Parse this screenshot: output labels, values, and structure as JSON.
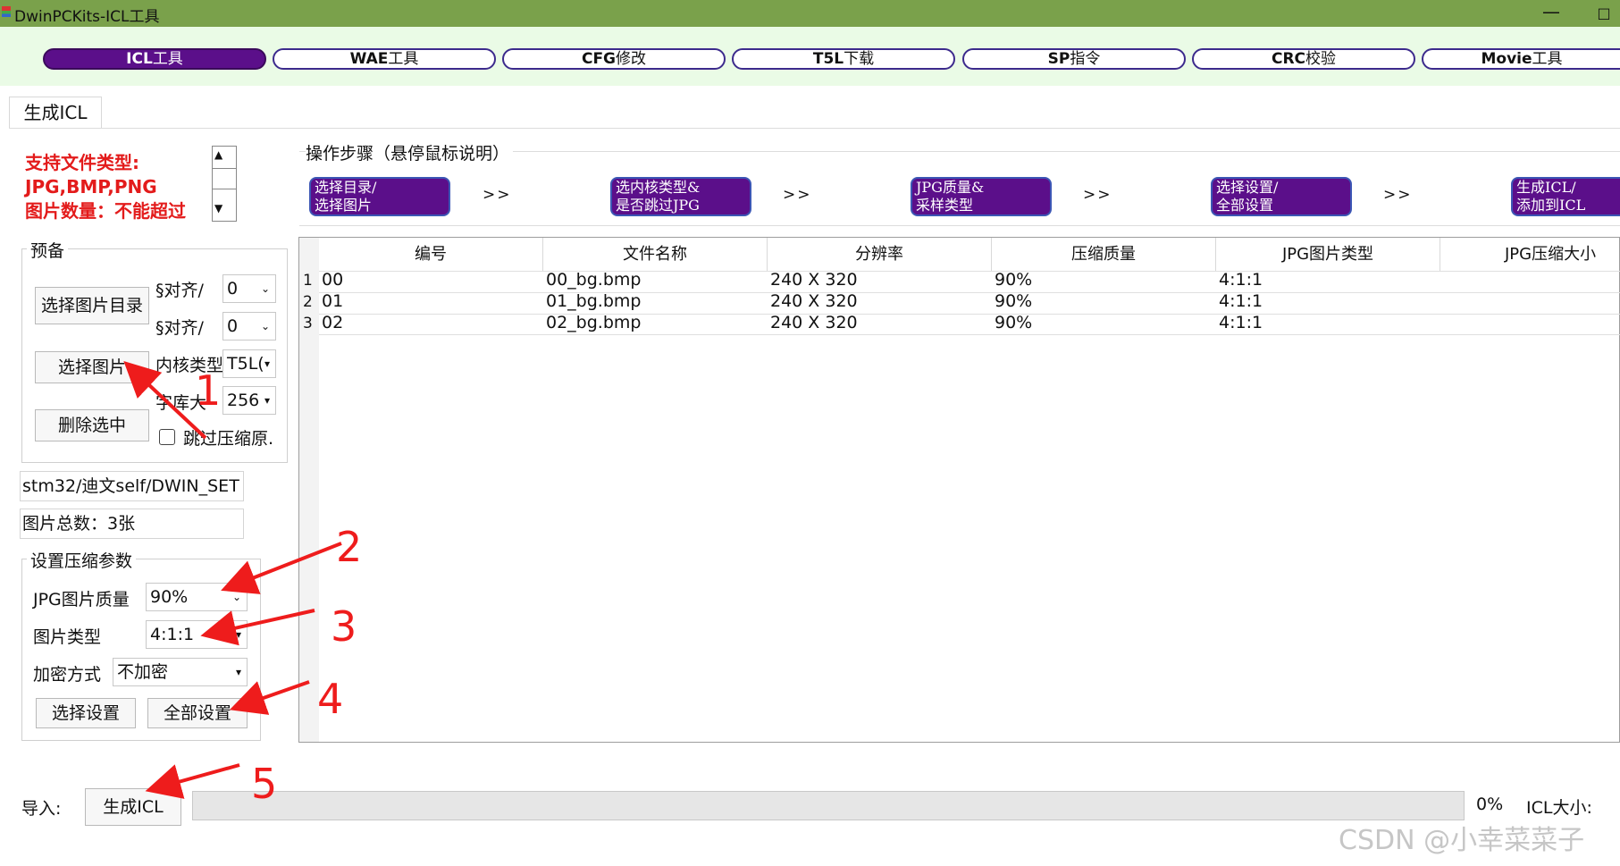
{
  "window": {
    "title": "DwinPCKits-ICL工具",
    "minimize": "—",
    "maximize": "□"
  },
  "tools": [
    {
      "bold": "ICL",
      "rest": "工具"
    },
    {
      "bold": "WAE",
      "rest": "工具"
    },
    {
      "bold": "CFG",
      "rest": "修改"
    },
    {
      "bold": "T5L",
      "rest": "下载"
    },
    {
      "bold": "SP",
      "rest": "指令"
    },
    {
      "bold": "CRC",
      "rest": "校验"
    },
    {
      "bold": "Movie",
      "rest": "工具"
    }
  ],
  "page_tab": "生成ICL",
  "support": {
    "line1": "支持文件类型:",
    "line2": "JPG,BMP,PNG",
    "line3": "图片数量：不能超过"
  },
  "scroll": {
    "up": "▲",
    "down": "▼"
  },
  "prep": {
    "title": "预备",
    "select_dir": "选择图片目录",
    "select_images": "选择图片",
    "delete_selected": "删除选中",
    "hv_align_label": "§对齐/",
    "v_align_label": "§对齐/",
    "hv_align_value": "0",
    "v_align_value": "0",
    "core_label": "内核类型",
    "core_value": "T5L(",
    "lib_label": "字库大",
    "lib_value": "256",
    "skip_label": "跳过压缩原.",
    "dropdown_arrow": "⌄",
    "small_arrow": "▾"
  },
  "path_field": "stm32/迪文self/DWIN_SET",
  "total_field": "图片总数：3张",
  "compress": {
    "title": "设置压缩参数",
    "quality_label": "JPG图片质量",
    "quality_value": "90%",
    "type_label": "图片类型",
    "type_value": "4:1:1",
    "encrypt_label": "加密方式",
    "encrypt_value": "不加密",
    "select_setting": "选择设置",
    "all_setting": "全部设置"
  },
  "steps": {
    "title": "操作步骤（悬停鼠标说明）",
    "arrow": ">>",
    "items": [
      {
        "l1": "选择目录/",
        "l2": "选择图片"
      },
      {
        "l1": "选内核类型&",
        "l2": "是否跳过JPG"
      },
      {
        "l1": "JPG质量&",
        "l2": "采样类型"
      },
      {
        "l1": "选择设置/",
        "l2": "全部设置"
      },
      {
        "l1": "生成ICL/",
        "l2": "添加到ICL"
      }
    ]
  },
  "table": {
    "columns": [
      "编号",
      "文件名称",
      "分辨率",
      "压缩质量",
      "JPG图片类型",
      "JPG压缩大小"
    ],
    "rows": [
      {
        "n": "1",
        "id": "00",
        "file": "00_bg.bmp",
        "res": "240 X 320",
        "q": "90%",
        "type": "4:1:1"
      },
      {
        "n": "2",
        "id": "01",
        "file": "01_bg.bmp",
        "res": "240 X 320",
        "q": "90%",
        "type": "4:1:1"
      },
      {
        "n": "3",
        "id": "02",
        "file": "02_bg.bmp",
        "res": "240 X 320",
        "q": "90%",
        "type": "4:1:1"
      }
    ]
  },
  "bottom": {
    "import_label": "导入:",
    "generate": "生成ICL",
    "progress": 0,
    "percent": "0%",
    "icl_size": "ICL大小:"
  },
  "annotations": {
    "n1": "1",
    "n2": "2",
    "n3": "3",
    "n4": "4",
    "n5": "5",
    "color": "#ee1c1c"
  },
  "watermark": "CSDN @小幸菜菜子"
}
